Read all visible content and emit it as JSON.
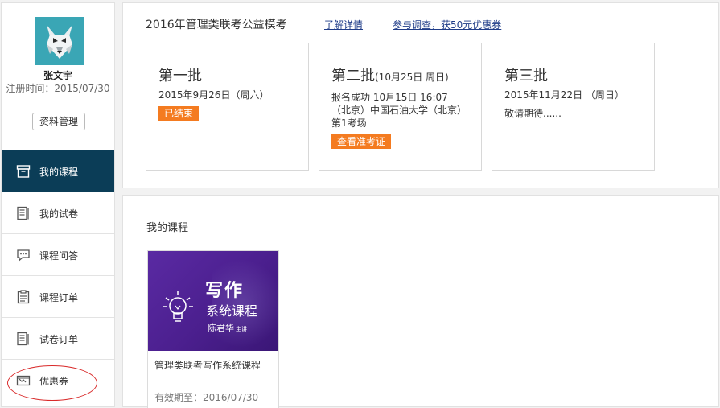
{
  "user": {
    "name": "张文宇",
    "reg_time": "注册时间：2015/07/30",
    "profile_button": "资料管理"
  },
  "sidebar": {
    "items": [
      {
        "label": "我的课程",
        "icon": "course-box-icon",
        "active": true
      },
      {
        "label": "我的试卷",
        "icon": "exam-paper-icon",
        "active": false
      },
      {
        "label": "课程问答",
        "icon": "chat-bubble-icon",
        "active": false
      },
      {
        "label": "课程订单",
        "icon": "clipboard-icon",
        "active": false
      },
      {
        "label": "试卷订单",
        "icon": "document-list-icon",
        "active": false
      },
      {
        "label": "优惠券",
        "icon": "coupon-icon",
        "active": false
      }
    ]
  },
  "mock_exam": {
    "title": "2016年管理类联考公益模考",
    "link_details": "了解详情",
    "link_survey": "参与调查，获50元优惠券",
    "batches": [
      {
        "name": "第一批",
        "date": "2015年9月26日（周六）",
        "badge": "已结束"
      },
      {
        "name": "第二批",
        "name_sub": "(10月25日 周日)",
        "lines": [
          "报名成功 10月15日 16:07",
          "（北京）中国石油大学（北京）",
          "第1考场"
        ],
        "badge": "查看准考证"
      },
      {
        "name": "第三批",
        "date": "2015年11月22日 （周日）",
        "note": "敬请期待......"
      }
    ]
  },
  "my_courses": {
    "title": "我的课程",
    "courses": [
      {
        "thumb_title": "写作",
        "thumb_subtitle": "系统课程",
        "thumb_author": "陈君华",
        "thumb_author_suffix": "主讲",
        "name": "管理类联考写作系统课程",
        "expiry": "有效期至：2016/07/30"
      }
    ]
  },
  "colors": {
    "active_nav": "#0b3d57",
    "badge": "#f47b20",
    "link": "#1f3c88",
    "thumb_purple": "#4b1f8e",
    "highlight": "#d92b2b"
  }
}
